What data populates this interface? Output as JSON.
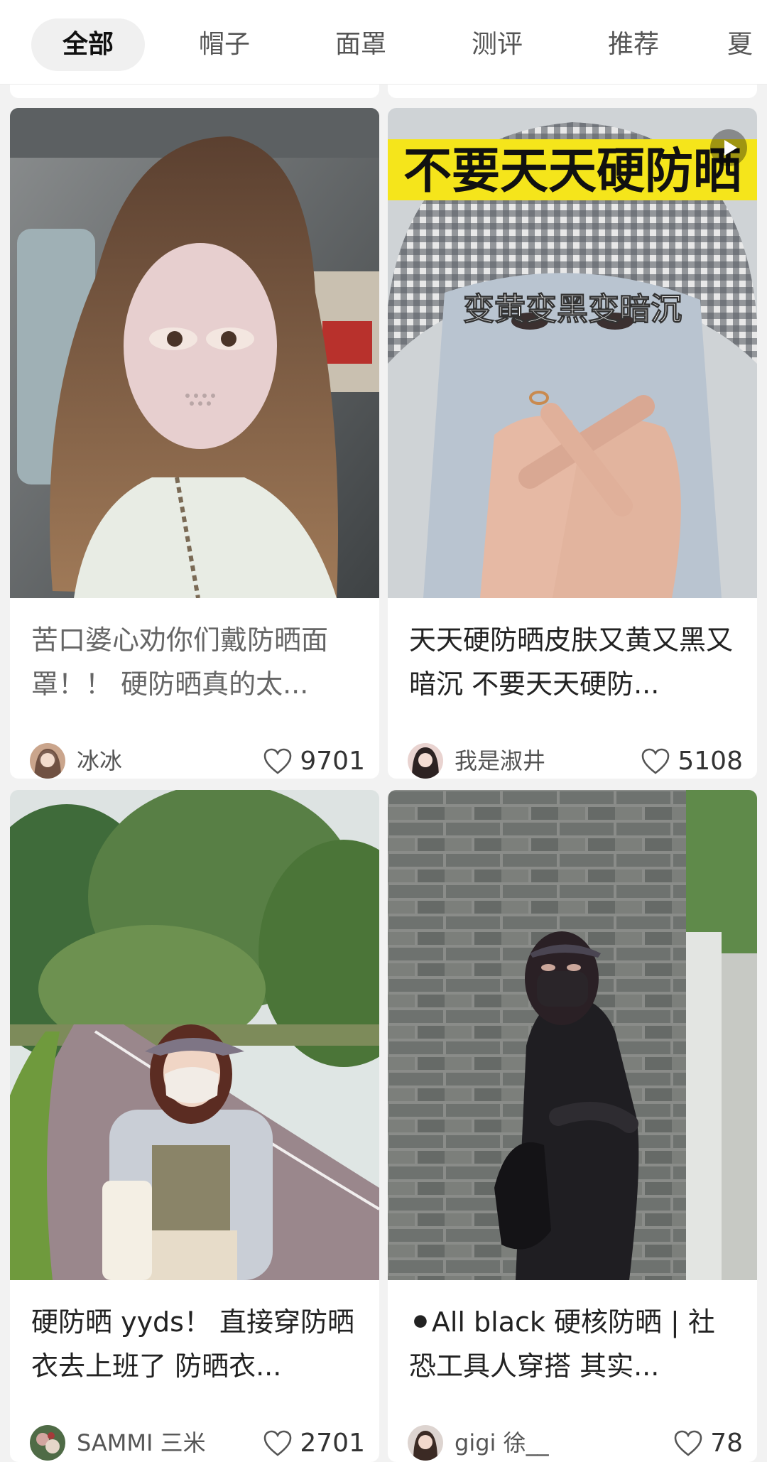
{
  "tabs": [
    {
      "label": "全部",
      "active": true
    },
    {
      "label": "帽子",
      "active": false
    },
    {
      "label": "面罩",
      "active": false
    },
    {
      "label": "测评",
      "active": false
    },
    {
      "label": "推荐",
      "active": false
    },
    {
      "label": "夏",
      "active": false
    }
  ],
  "cards": [
    {
      "title": "苦口婆心劝你们戴防晒面罩！！ 硬防晒真的太...",
      "author": "冰冰",
      "likes": "9701"
    },
    {
      "title": "天天硬防晒皮肤又黄又黑又暗沉 不要天天硬防...",
      "author": "我是淑井",
      "likes": "5108",
      "overlay_top": "不要天天硬防晒",
      "overlay_middle": "变黄变黑变暗沉"
    },
    {
      "title": "硬防晒 yyds！ 直接穿防晒衣去上班了 防晒衣...",
      "author": "SAMMI 三米",
      "likes": "2701"
    },
    {
      "title": "⚫All black 硬核防晒 | 社恐工具人穿搭 其实...",
      "author": "gigi 徐__",
      "likes": "78"
    }
  ],
  "colors": {
    "background": "#f2f2f2",
    "card": "#ffffff",
    "overlay_yellow": "#f5e51b"
  },
  "icons": [
    "heart-icon",
    "play-icon",
    "avatar"
  ]
}
